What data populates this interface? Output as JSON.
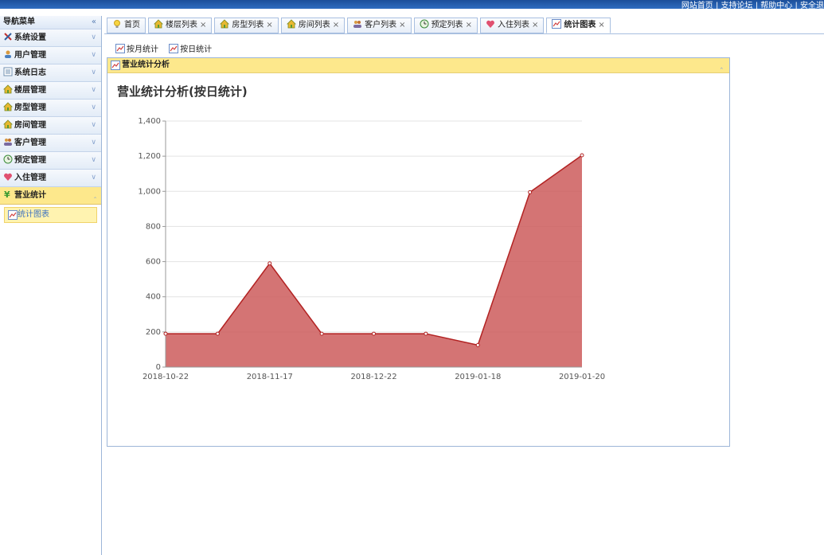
{
  "header": {
    "links": "网站首页 | 支持论坛 | 帮助中心 | 安全退"
  },
  "sidebar": {
    "title": "导航菜单",
    "collapse_glyph": "«",
    "items": [
      {
        "label": "系统设置",
        "icon": "tools-icon"
      },
      {
        "label": "用户管理",
        "icon": "user-icon"
      },
      {
        "label": "系统日志",
        "icon": "log-icon"
      },
      {
        "label": "楼层管理",
        "icon": "house-icon"
      },
      {
        "label": "房型管理",
        "icon": "house-icon"
      },
      {
        "label": "房间管理",
        "icon": "house-icon"
      },
      {
        "label": "客户管理",
        "icon": "users-icon"
      },
      {
        "label": "预定管理",
        "icon": "clock-icon"
      },
      {
        "label": "入住管理",
        "icon": "heart-icon"
      },
      {
        "label": "营业统计",
        "icon": "money-icon",
        "active": true
      }
    ],
    "sub_item": "统计图表"
  },
  "tabs": [
    {
      "label": "首页",
      "closable": false
    },
    {
      "label": "楼层列表",
      "closable": true
    },
    {
      "label": "房型列表",
      "closable": true
    },
    {
      "label": "房间列表",
      "closable": true
    },
    {
      "label": "客户列表",
      "closable": true
    },
    {
      "label": "预定列表",
      "closable": true
    },
    {
      "label": "入住列表",
      "closable": true
    },
    {
      "label": "统计图表",
      "closable": true,
      "active": true
    }
  ],
  "toolbar": {
    "by_month": "按月统计",
    "by_day": "按日统计"
  },
  "panel": {
    "title": "营业统计分析"
  },
  "colors": {
    "area_fill": "#cd5c5c",
    "area_line": "#b22222",
    "panel_header": "#fde88c"
  },
  "chart_data": {
    "type": "area",
    "title": "营业统计分析(按日统计)",
    "x": [
      "2018-10-22",
      "",
      "2018-11-17",
      "",
      "2018-12-22",
      "",
      "2019-01-18",
      "",
      "2019-01-20"
    ],
    "series": [
      {
        "values": [
          190,
          190,
          590,
          190,
          190,
          190,
          125,
          995,
          1205
        ]
      }
    ],
    "ylim": [
      0,
      1400
    ],
    "yticks": [
      "0",
      "200",
      "400",
      "600",
      "800",
      "1,000",
      "1,200",
      "1,400"
    ],
    "xlabel": "",
    "ylabel": "",
    "grid": true,
    "legend": "none"
  }
}
